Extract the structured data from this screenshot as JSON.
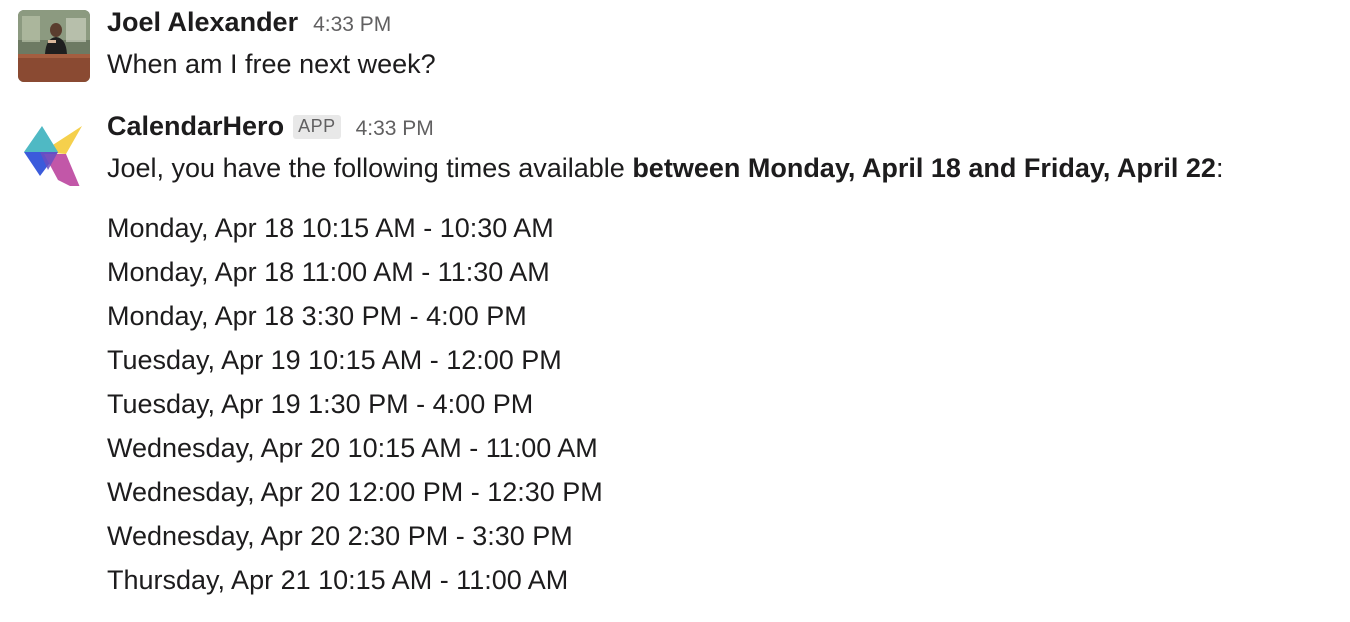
{
  "messages": [
    {
      "sender": "Joel Alexander",
      "time": "4:33 PM",
      "text": "When am I free next week?"
    },
    {
      "sender": "CalendarHero",
      "badge": "APP",
      "time": "4:33 PM",
      "intro_prefix": "Joel, you have the following times available ",
      "intro_bold": "between Monday, April 18 and Friday, April 22",
      "intro_suffix": ":",
      "slots": [
        "Monday, Apr 18 10:15 AM - 10:30 AM",
        "Monday, Apr 18 11:00 AM - 11:30 AM",
        "Monday, Apr 18 3:30 PM - 4:00 PM",
        "Tuesday, Apr 19 10:15 AM - 12:00 PM",
        "Tuesday, Apr 19 1:30 PM - 4:00 PM",
        "Wednesday, Apr 20 10:15 AM - 11:00 AM",
        "Wednesday, Apr 20 12:00 PM - 12:30 PM",
        "Wednesday, Apr 20 2:30 PM - 3:30 PM",
        "Thursday, Apr 21 10:15 AM - 11:00 AM"
      ]
    }
  ],
  "colors": {
    "text": "#1d1c1d",
    "muted": "#616061",
    "badge_bg": "#e8e8e8",
    "logo_yellow": "#f5d04c",
    "logo_teal": "#4fb9c4",
    "logo_blue": "#3b5bdb",
    "logo_pink": "#c257a8"
  },
  "icons": {
    "user_avatar": "user-photo-avatar",
    "app_avatar": "calendarhero-logo-icon"
  }
}
